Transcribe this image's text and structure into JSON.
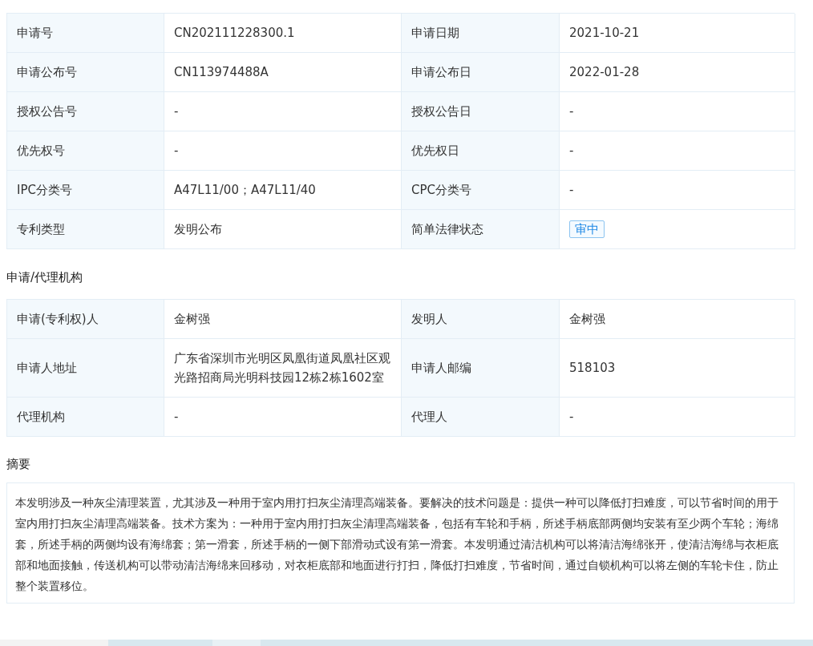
{
  "basic_info": {
    "rows": [
      [
        {
          "label": "申请号",
          "value": "CN202111228300.1",
          "kind": "text"
        },
        {
          "label": "申请日期",
          "value": "2021-10-21",
          "kind": "text"
        }
      ],
      [
        {
          "label": "申请公布号",
          "value": "CN113974488A",
          "kind": "text"
        },
        {
          "label": "申请公布日",
          "value": "2022-01-28",
          "kind": "text"
        }
      ],
      [
        {
          "label": "授权公告号",
          "value": "-",
          "kind": "text"
        },
        {
          "label": "授权公告日",
          "value": "-",
          "kind": "text"
        }
      ],
      [
        {
          "label": "优先权号",
          "value": "-",
          "kind": "text"
        },
        {
          "label": "优先权日",
          "value": "-",
          "kind": "text"
        }
      ],
      [
        {
          "label": "IPC分类号",
          "value": "A47L11/00；A47L11/40",
          "kind": "text"
        },
        {
          "label": "CPC分类号",
          "value": "-",
          "kind": "text"
        }
      ],
      [
        {
          "label": "专利类型",
          "value": "发明公布",
          "kind": "text"
        },
        {
          "label": "简单法律状态",
          "value": "审中",
          "kind": "tag"
        }
      ]
    ]
  },
  "applicant_section": {
    "title": "申请/代理机构",
    "rows": [
      [
        {
          "label": "申请(专利权)人",
          "value": "金树强",
          "kind": "text"
        },
        {
          "label": "发明人",
          "value": "金树强",
          "kind": "text"
        }
      ],
      [
        {
          "label": "申请人地址",
          "value": "广东省深圳市光明区凤凰街道凤凰社区观光路招商局光明科技园12栋2栋1602室",
          "kind": "text"
        },
        {
          "label": "申请人邮编",
          "value": "518103",
          "kind": "text"
        }
      ],
      [
        {
          "label": "代理机构",
          "value": "-",
          "kind": "text"
        },
        {
          "label": "代理人",
          "value": "-",
          "kind": "text"
        }
      ]
    ]
  },
  "abstract": {
    "title": "摘要",
    "text": "本发明涉及一种灰尘清理装置，尤其涉及一种用于室内用打扫灰尘清理高端装备。要解决的技术问题是：提供一种可以降低打扫难度，可以节省时间的用于室内用打扫灰尘清理高端装备。技术方案为：一种用于室内用打扫灰尘清理高端装备，包括有车轮和手柄，所述手柄底部两侧均安装有至少两个车轮；海绵套，所述手柄的两侧均设有海绵套；第一滑套，所述手柄的一侧下部滑动式设有第一滑套。本发明通过清洁机构可以将清洁海绵张开，使清洁海绵与衣柜底部和地面接触，传送机构可以带动清洁海绵来回移动，对衣柜底部和地面进行打扫，降低打扫难度，节省时间，通过自锁机构可以将左侧的车轮卡住，防止整个装置移位。"
  }
}
